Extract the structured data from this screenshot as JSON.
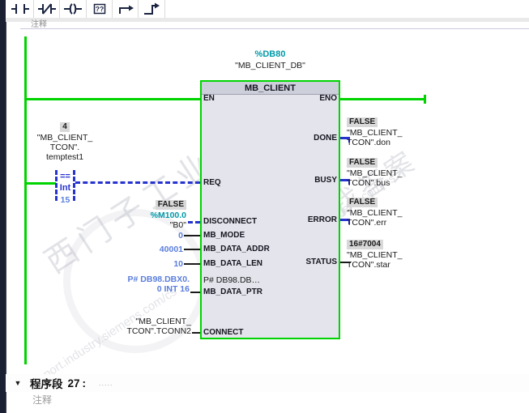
{
  "toolbar": {
    "empty_box_label": "??",
    "icons": [
      "no-contact-icon",
      "nc-contact-icon",
      "coil-icon",
      "empty-box-icon",
      "open-branch-icon",
      "close-branch-icon"
    ]
  },
  "top_area": {
    "comment_remnant": "注释"
  },
  "call": {
    "db_address": "%DB80",
    "db_name": "\"MB_CLIENT_DB\"",
    "block_title": "MB_CLIENT"
  },
  "pins": {
    "en": "EN",
    "eno": "ENO",
    "req": "REQ",
    "disconnect": "DISCONNECT",
    "mb_mode": "MB_MODE",
    "mb_data_addr": "MB_DATA_ADDR",
    "mb_data_len": "MB_DATA_LEN",
    "mb_data_ptr": "MB_DATA_PTR",
    "mb_data_ptr_inline_value": "P# DB98.DB…",
    "connect": "CONNECT",
    "done": "DONE",
    "busy": "BUSY",
    "error": "ERROR",
    "status": "STATUS"
  },
  "req_branch": {
    "monitor_value": "4",
    "operand_line1": "\"MB_CLIENT_",
    "operand_line2": "TCON\".",
    "operand_line3": "temptest1",
    "compare_op": "==",
    "compare_type": "Int",
    "compare_value": "15"
  },
  "inputs": {
    "disconnect": {
      "monitor_value": "FALSE",
      "address": "%M100.0",
      "name": "\"B0\""
    },
    "mb_mode": {
      "value": "0"
    },
    "mb_data_addr": {
      "value": "40001"
    },
    "mb_data_len": {
      "value": "10"
    },
    "mb_data_ptr": {
      "value_line1": "P# DB98.DBX0.",
      "value_line2": "0 INT 16"
    },
    "connect": {
      "operand_line1": "\"MB_CLIENT_",
      "operand_line2": "TCON\".TCONN2"
    }
  },
  "outputs": {
    "done": {
      "monitor_value": "FALSE",
      "operand_line1": "\"MB_CLIENT_",
      "operand_line2": "TCON\".don"
    },
    "busy": {
      "monitor_value": "FALSE",
      "operand_line1": "\"MB_CLIENT_",
      "operand_line2": "TCON\".bus"
    },
    "error": {
      "monitor_value": "FALSE",
      "operand_line1": "\"MB_CLIENT_",
      "operand_line2": "TCON\".err"
    },
    "status": {
      "monitor_value": "16#7004",
      "operand_line1": "\"MB_CLIENT_",
      "operand_line2": "TCON\".star"
    }
  },
  "network": {
    "collapse_icon": "▼",
    "label": "程序段",
    "number": "27",
    "separator": ":",
    "dots": ".....",
    "comment_placeholder": "注释"
  },
  "watermarks": {
    "w1": "西门子工业",
    "w2": "找答案",
    "w3": "support.industry.siemens.com/cs",
    "w4": "support.industry.siemens.com/cs"
  },
  "colors": {
    "power_flow_green": "#00d400",
    "signal_blue": "#2633cf",
    "value_blue": "#5a7edc",
    "address_teal": "#0099a8",
    "monitor_badge_gray": "#d8d8d8",
    "block_body": "#e3e4ec",
    "block_header": "#cdcfdb"
  }
}
